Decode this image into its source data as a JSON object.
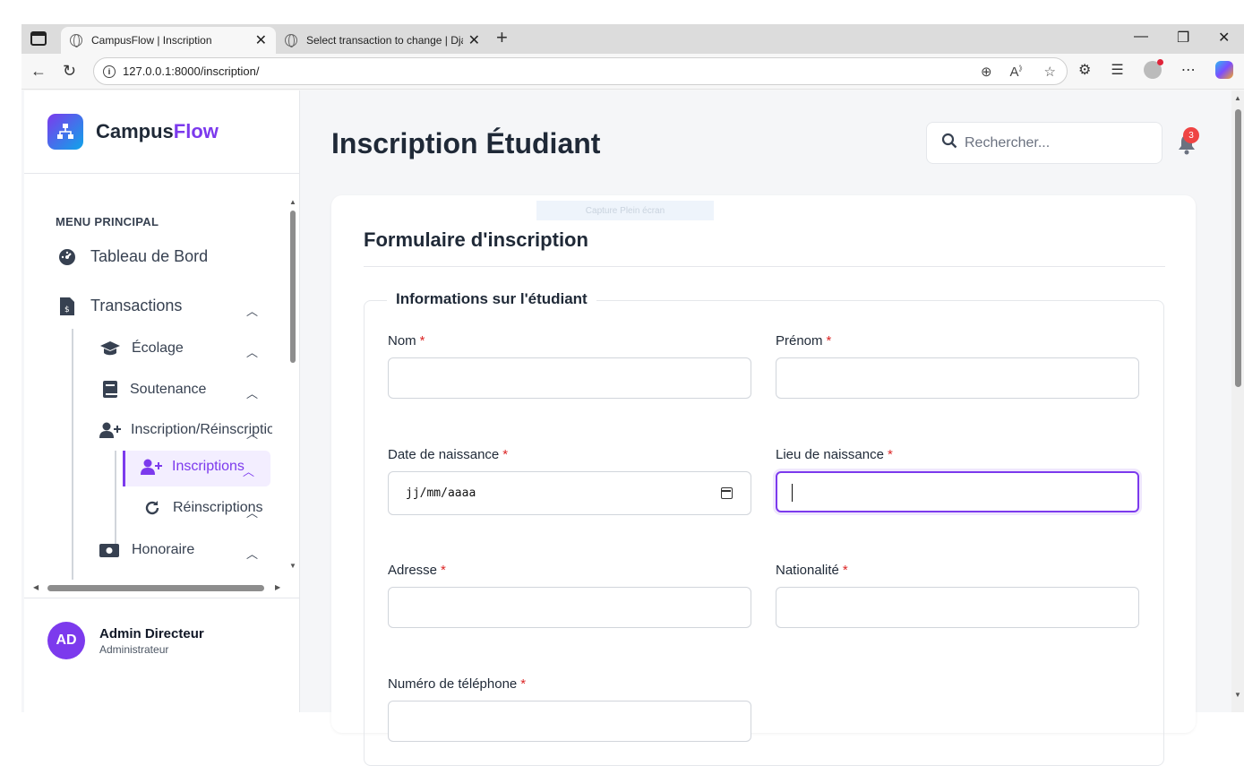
{
  "browser": {
    "tabs": [
      {
        "title": "CampusFlow | Inscription",
        "close": "✕"
      },
      {
        "title": "Select transaction to change | Dja",
        "close": "✕"
      }
    ],
    "new_tab": "+",
    "window_controls": {
      "minimize": "—",
      "restore": "❐",
      "close": "✕"
    },
    "nav": {
      "back": "←",
      "reload": "↻"
    },
    "url": "127.0.0.1:8000/inscription/",
    "omnibox_icons": [
      "zoom-icon",
      "read-aloud-icon",
      "favorite-icon"
    ],
    "toolbar_icons": [
      "extensions-icon",
      "collections-icon",
      "profile-icon",
      "more-icon",
      "copilot-icon"
    ]
  },
  "sidebar": {
    "brand_prefix": "Campus",
    "brand_accent": "Flow",
    "menu_heading": "MENU PRINCIPAL",
    "items": [
      {
        "label": "Tableau de Bord",
        "icon": "dashboard-icon"
      },
      {
        "label": "Transactions",
        "icon": "invoice-icon"
      },
      {
        "label": "Écolage",
        "icon": "graduation-cap-icon"
      },
      {
        "label": "Soutenance",
        "icon": "book-icon"
      },
      {
        "label": "Inscription/Réinscription",
        "icon": "user-plus-icon"
      },
      {
        "label": "Inscriptions",
        "icon": "user-plus-icon"
      },
      {
        "label": "Réinscriptions",
        "icon": "redo-icon"
      },
      {
        "label": "Honoraire",
        "icon": "money-icon"
      }
    ],
    "user": {
      "initials": "AD",
      "name": "Admin Directeur",
      "role": "Administrateur"
    }
  },
  "header": {
    "title": "Inscription Étudiant",
    "search_placeholder": "Rechercher...",
    "notification_count": "3"
  },
  "overlay": {
    "capture_label": "Capture Plein écran"
  },
  "form": {
    "title": "Formulaire d'inscription",
    "legend": "Informations sur l'étudiant",
    "required_mark": "*",
    "fields": [
      {
        "label": "Nom",
        "value": ""
      },
      {
        "label": "Prénom",
        "value": ""
      },
      {
        "label": "Date de naissance",
        "value": "jj/mm/aaaa"
      },
      {
        "label": "Lieu de naissance",
        "value": ""
      },
      {
        "label": "Adresse",
        "value": ""
      },
      {
        "label": "Nationalité",
        "value": ""
      },
      {
        "label": "Numéro de téléphone",
        "value": ""
      }
    ]
  },
  "colors": {
    "accent": "#7c3aed",
    "required": "#dc2626",
    "badge": "#ef4444",
    "active_bg": "#f3eeff"
  }
}
